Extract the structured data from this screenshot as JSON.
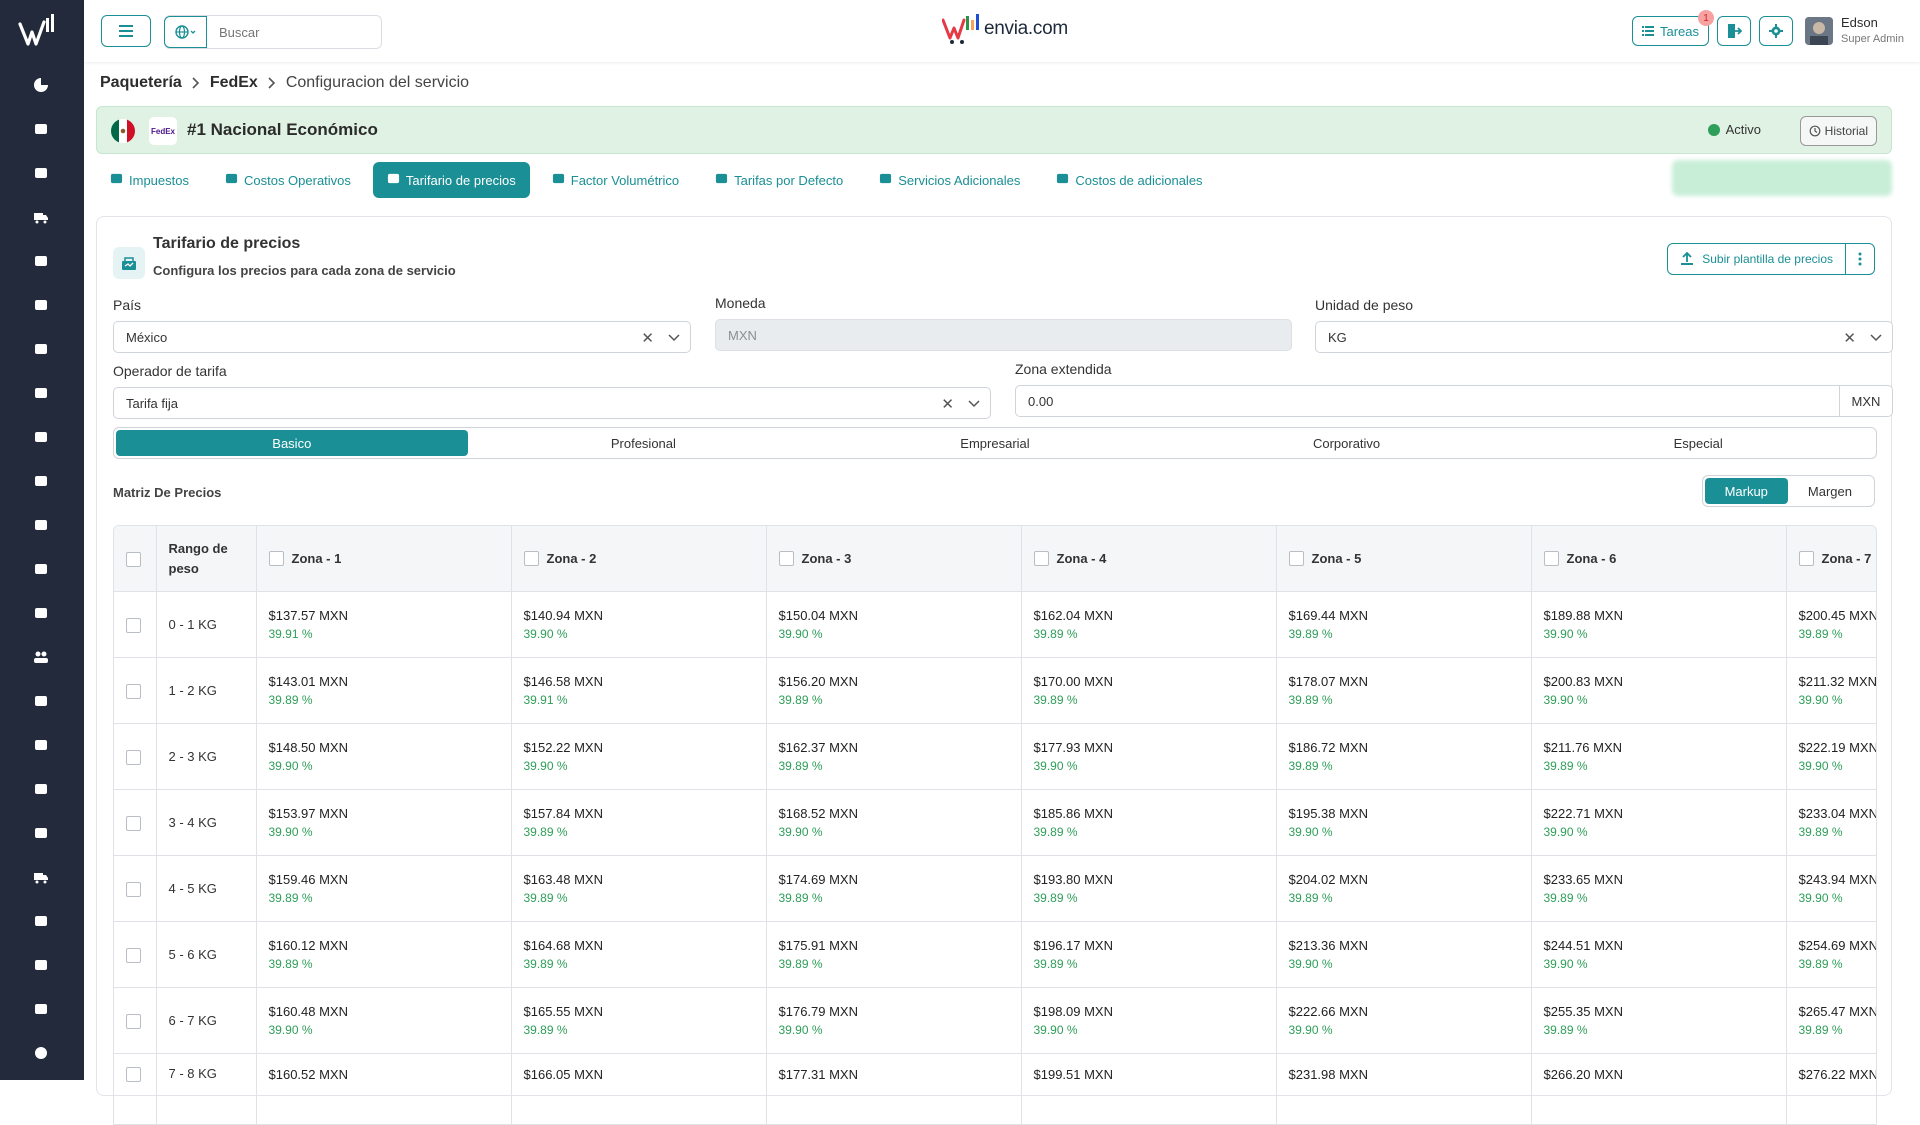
{
  "header": {
    "search_placeholder": "Buscar",
    "brand": "envia.com",
    "tareas_label": "Tareas",
    "tareas_count": "1",
    "user_name": "Edson",
    "user_role": "Super Admin"
  },
  "breadcrumb": {
    "level1": "Paquetería",
    "level2": "FedEx",
    "current": "Configuracion del servicio"
  },
  "service": {
    "carrier_logo_text": "FedEx",
    "title": "#1 Nacional Económico",
    "status": "Activo",
    "historial": "Historial"
  },
  "tabs": [
    {
      "label": "Impuestos",
      "icon": "percent-icon"
    },
    {
      "label": "Costos Operativos",
      "icon": "coins-icon"
    },
    {
      "label": "Tarifario de precios",
      "icon": "rate-icon"
    },
    {
      "label": "Factor Volumétrico",
      "icon": "cube-icon"
    },
    {
      "label": "Tarifas por Defecto",
      "icon": "box-icon"
    },
    {
      "label": "Servicios Adicionales",
      "icon": "puzzle-icon"
    },
    {
      "label": "Costos de adicionales",
      "icon": "hand-coin-icon"
    }
  ],
  "card": {
    "title": "Tarifario de precios",
    "subtitle": "Configura los precios para cada zona de servicio",
    "upload_label": "Subir plantilla de precios"
  },
  "form": {
    "pais_label": "País",
    "pais_value": "México",
    "moneda_label": "Moneda",
    "moneda_placeholder": "MXN",
    "unidad_label": "Unidad de peso",
    "unidad_value": "KG",
    "operador_label": "Operador de tarifa",
    "operador_value": "Tarifa fija",
    "zona_ext_label": "Zona extendida",
    "zona_ext_value": "0.00",
    "zona_ext_suffix": "MXN"
  },
  "plans": [
    "Basico",
    "Profesional",
    "Empresarial",
    "Corporativo",
    "Especial"
  ],
  "matrix": {
    "title": "Matriz De Precios",
    "toggle": [
      "Markup",
      "Margen"
    ],
    "range_header": "Rango de peso",
    "zones": [
      "Zona - 1",
      "Zona - 2",
      "Zona - 3",
      "Zona - 4",
      "Zona - 5",
      "Zona - 6",
      "Zona - 7"
    ],
    "rows": [
      {
        "range": "0 - 1 KG",
        "cells": [
          [
            "$137.57 MXN",
            "39.91 %"
          ],
          [
            "$140.94 MXN",
            "39.90 %"
          ],
          [
            "$150.04 MXN",
            "39.90 %"
          ],
          [
            "$162.04 MXN",
            "39.89 %"
          ],
          [
            "$169.44 MXN",
            "39.89 %"
          ],
          [
            "$189.88 MXN",
            "39.90 %"
          ],
          [
            "$200.45 MXN",
            "39.89 %"
          ]
        ]
      },
      {
        "range": "1 - 2 KG",
        "cells": [
          [
            "$143.01 MXN",
            "39.89 %"
          ],
          [
            "$146.58 MXN",
            "39.91 %"
          ],
          [
            "$156.20 MXN",
            "39.89 %"
          ],
          [
            "$170.00 MXN",
            "39.89 %"
          ],
          [
            "$178.07 MXN",
            "39.89 %"
          ],
          [
            "$200.83 MXN",
            "39.90 %"
          ],
          [
            "$211.32 MXN",
            "39.90 %"
          ]
        ]
      },
      {
        "range": "2 - 3 KG",
        "cells": [
          [
            "$148.50 MXN",
            "39.90 %"
          ],
          [
            "$152.22 MXN",
            "39.90 %"
          ],
          [
            "$162.37 MXN",
            "39.89 %"
          ],
          [
            "$177.93 MXN",
            "39.90 %"
          ],
          [
            "$186.72 MXN",
            "39.89 %"
          ],
          [
            "$211.76 MXN",
            "39.89 %"
          ],
          [
            "$222.19 MXN",
            "39.90 %"
          ]
        ]
      },
      {
        "range": "3 - 4 KG",
        "cells": [
          [
            "$153.97 MXN",
            "39.90 %"
          ],
          [
            "$157.84 MXN",
            "39.89 %"
          ],
          [
            "$168.52 MXN",
            "39.90 %"
          ],
          [
            "$185.86 MXN",
            "39.89 %"
          ],
          [
            "$195.38 MXN",
            "39.90 %"
          ],
          [
            "$222.71 MXN",
            "39.90 %"
          ],
          [
            "$233.04 MXN",
            "39.89 %"
          ]
        ]
      },
      {
        "range": "4 - 5 KG",
        "cells": [
          [
            "$159.46 MXN",
            "39.89 %"
          ],
          [
            "$163.48 MXN",
            "39.89 %"
          ],
          [
            "$174.69 MXN",
            "39.89 %"
          ],
          [
            "$193.80 MXN",
            "39.89 %"
          ],
          [
            "$204.02 MXN",
            "39.89 %"
          ],
          [
            "$233.65 MXN",
            "39.89 %"
          ],
          [
            "$243.94 MXN",
            "39.90 %"
          ]
        ]
      },
      {
        "range": "5 - 6 KG",
        "cells": [
          [
            "$160.12 MXN",
            "39.89 %"
          ],
          [
            "$164.68 MXN",
            "39.89 %"
          ],
          [
            "$175.91 MXN",
            "39.89 %"
          ],
          [
            "$196.17 MXN",
            "39.89 %"
          ],
          [
            "$213.36 MXN",
            "39.90 %"
          ],
          [
            "$244.51 MXN",
            "39.90 %"
          ],
          [
            "$254.69 MXN",
            "39.89 %"
          ]
        ]
      },
      {
        "range": "6 - 7 KG",
        "cells": [
          [
            "$160.48 MXN",
            "39.90 %"
          ],
          [
            "$165.55 MXN",
            "39.89 %"
          ],
          [
            "$176.79 MXN",
            "39.90 %"
          ],
          [
            "$198.09 MXN",
            "39.90 %"
          ],
          [
            "$222.66 MXN",
            "39.90 %"
          ],
          [
            "$255.35 MXN",
            "39.89 %"
          ],
          [
            "$265.47 MXN",
            "39.89 %"
          ]
        ]
      },
      {
        "range": "7 - 8 KG",
        "cells": [
          [
            "$160.52 MXN",
            ""
          ],
          [
            "$166.05 MXN",
            ""
          ],
          [
            "$177.31 MXN",
            ""
          ],
          [
            "$199.51 MXN",
            ""
          ],
          [
            "$231.98 MXN",
            ""
          ],
          [
            "$266.20 MXN",
            ""
          ],
          [
            "$276.22 MXN",
            ""
          ]
        ]
      }
    ]
  },
  "colors": {
    "accent": "#1a8f95",
    "sidebar": "#232a3b",
    "banner": "#dff2e4",
    "percent": "#2e9e58"
  }
}
